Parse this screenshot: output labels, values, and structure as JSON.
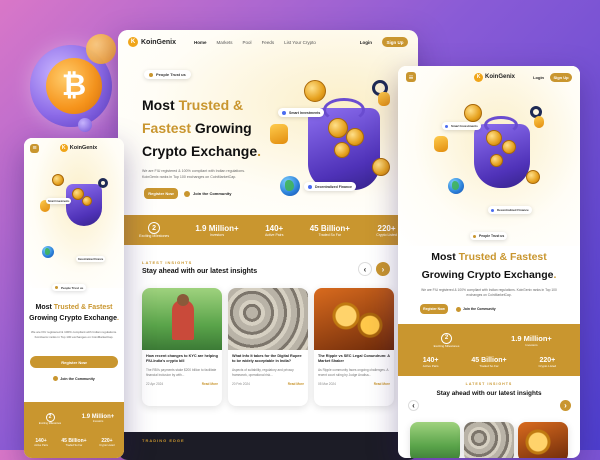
{
  "brand": {
    "name": "KoinGenix",
    "logo_letter": "K",
    "accent": "#c9962f"
  },
  "nav": {
    "items": [
      "Home",
      "Markets",
      "Pool",
      "Feeds",
      "List Your Crypto"
    ],
    "login": "Login",
    "signup": "Sign Up"
  },
  "hero": {
    "badge": "People Trust us",
    "line1_a": "Most ",
    "line1_b": "Trusted &",
    "line2_a": "Fastest ",
    "line2_b": "Growing",
    "line3": "Crypto Exchange",
    "line3_dot": ".",
    "desc": "We are FIU registered & 100% compliant with Indian regulations. KoinGenix ranks in Top 100 exchanges on CoinMarketCap.",
    "cta": "Register Now",
    "community": "Join the Community",
    "smart": "Smart Investments",
    "decentral": "Decentralized Finance"
  },
  "stats": [
    {
      "value": "2",
      "label": "Exciting Milestones"
    },
    {
      "value": "1.9 Million+",
      "label": "Investors"
    },
    {
      "value": "140+",
      "label": "Active Pairs"
    },
    {
      "value": "45 Billion+",
      "label": "Traded So Far"
    },
    {
      "value": "220+",
      "label": "Crypto Listed"
    }
  ],
  "insights": {
    "eyebrow": "LATEST INSIGHTS",
    "title": "Stay ahead with our latest insights",
    "prev": "‹",
    "next": "›"
  },
  "articles": [
    {
      "title": "How recent changes to KYC are helping FIU-India's crypto bill",
      "excerpt": "The RBI's payments stake $200 billion to facilitate financial inclusion by with...",
      "date": "22 Apr 2024",
      "more": "Read More"
    },
    {
      "title": "What Info It takes for the Digital Rupee to be widely acceptable in India?",
      "excerpt": "Aspects of suitability, regulatory and privacy framework, operational risk...",
      "date": "20 Feb 2024",
      "more": "Read More"
    },
    {
      "title": "The Ripple vs SEC Legal Conundrum: A Market Shaker",
      "excerpt": "As Ripple community faces ongoing challenges. A recent court ruling by Judge Analisa...",
      "date": "05 Mar 2024",
      "more": "Read More"
    }
  ],
  "trading": {
    "eyebrow": "TRADING EDGE"
  },
  "mobile": {
    "line1_a": "Most ",
    "line1_b": "Trusted & Fastest",
    "line2": "Growing Crypto Exchange",
    "line2_dot": ".",
    "desc": "We are FIU registered & 100% compliant with Indian regulations. KoinGenix ranks in Top 100 exchanges on CoinMarketCap.",
    "cta": "Register Now",
    "community": "Join the Community"
  },
  "bitcoin_symbol": "₿",
  "menu_icon": "≡"
}
